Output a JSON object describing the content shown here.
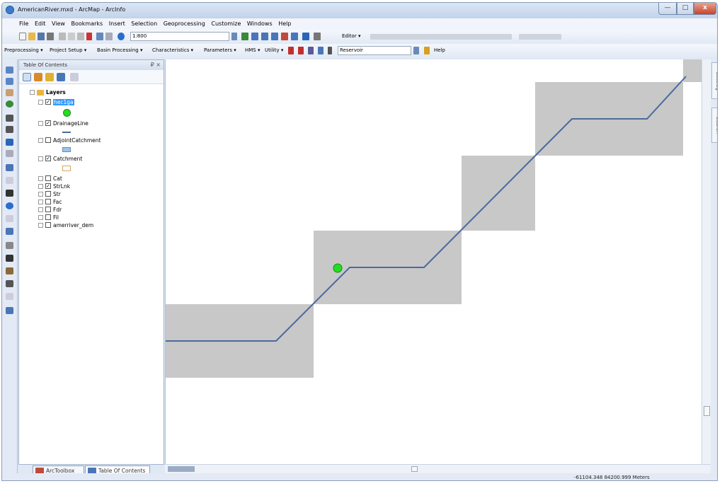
{
  "window": {
    "title": "AmericanRiver.mxd - ArcMap - ArcInfo",
    "minimize": "—",
    "maximize": "□",
    "close": "x"
  },
  "menu": [
    "File",
    "Edit",
    "View",
    "Bookmarks",
    "Insert",
    "Selection",
    "Geoprocessing",
    "Customize",
    "Windows",
    "Help"
  ],
  "standard_toolbar": {
    "scale": "1:800",
    "editor_label": "Editor ▾"
  },
  "hydro_toolbar": {
    "items": [
      "Preprocessing ▾",
      "Project Setup ▾",
      "Basin Processing ▾",
      "Characteristics ▾",
      "Parameters ▾",
      "HMS ▾",
      "Utility ▾"
    ],
    "layer_combo": "Reservoir",
    "help": "Help"
  },
  "toc": {
    "title": "Table Of Contents",
    "pin": "₽ ×",
    "group": "Layers",
    "layers": [
      {
        "name": "hec1ga",
        "checked": true,
        "selected": true
      },
      {
        "name": "DrainageLine",
        "checked": true
      },
      {
        "name": "AdjointCatchment",
        "checked": false
      },
      {
        "name": "Catchment",
        "checked": true
      },
      {
        "name": "Cat",
        "checked": false
      },
      {
        "name": "StrLnk",
        "checked": true
      },
      {
        "name": "Str",
        "checked": false
      },
      {
        "name": "Fac",
        "checked": false
      },
      {
        "name": "Fdr",
        "checked": false
      },
      {
        "name": "Fil",
        "checked": false
      },
      {
        "name": "amerriver_dem",
        "checked": false
      }
    ],
    "tabs": [
      "ArcToolbox",
      "Table Of Contents"
    ]
  },
  "side_tabs": [
    "Catalog",
    "Search"
  ],
  "status": {
    "coordinates": "-61104.348  84200.999 Meters"
  },
  "colors": {
    "cell_fill": "#c8c8c8",
    "drainage_line": "#4a6a9e",
    "point": "#22cc22",
    "selection": "#3399ff"
  }
}
